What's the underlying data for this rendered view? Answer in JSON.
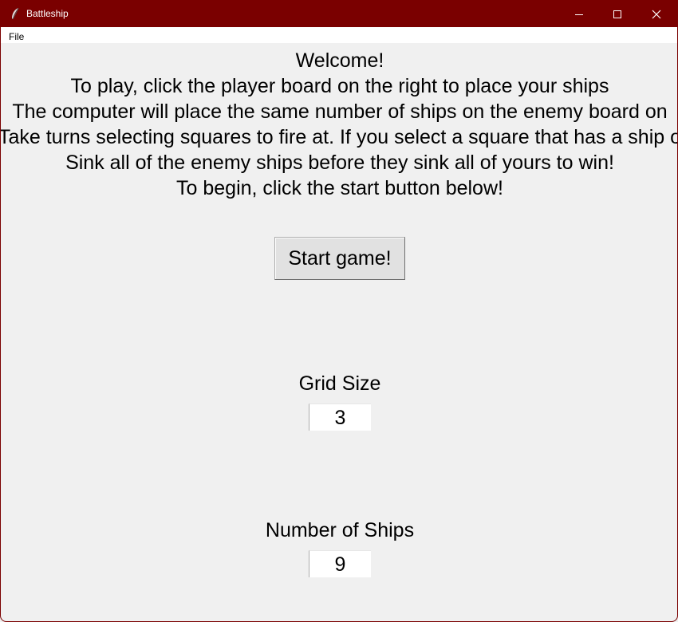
{
  "window": {
    "title": "Battleship",
    "accent_color": "#7a0000",
    "icons": {
      "app": "feather-icon",
      "minimize": "minimize-icon",
      "maximize": "maximize-icon",
      "close": "close-icon"
    }
  },
  "menubar": {
    "items": [
      {
        "label": "File"
      }
    ]
  },
  "instructions": {
    "lines": [
      "Welcome!",
      "To play, click the player board on the right to place your ships",
      "The computer will place the same number of ships on the enemy board on",
      "Take turns selecting squares to fire at. If you select a square that has a ship o",
      "Sink all of the enemy ships before they sink all of yours to win!",
      "To begin, click the start button below!"
    ]
  },
  "start_button": {
    "label": "Start game!"
  },
  "grid_size": {
    "label": "Grid Size",
    "value": "3"
  },
  "num_ships": {
    "label": "Number of Ships",
    "value": "9"
  }
}
